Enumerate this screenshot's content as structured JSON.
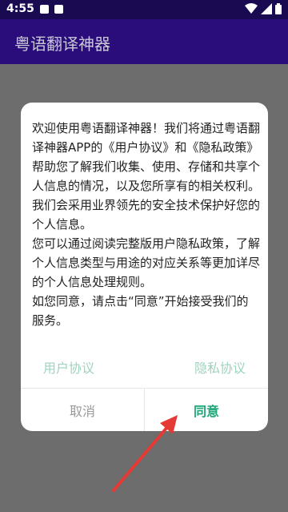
{
  "status_bar": {
    "time": "4:55",
    "icons": [
      "notification-icon",
      "notification-icon",
      "wifi-icon",
      "signal-icon",
      "battery-icon"
    ]
  },
  "app_bar": {
    "title": "粤语翻译神器"
  },
  "dialog": {
    "paragraphs": [
      "欢迎使用粤语翻译神器！我们将通过粤语翻译神器APP的《用户协议》和《隐私政策》帮助您了解我们收集、使用、存储和共享个人信息的情况，以及您所享有的相关权利。",
      "我们会采用业界领先的安全技术保护好您的个人信息。",
      "您可以通过阅读完整版用户隐私政策，了解个人信息类型与用途的对应关系等更加详尽的个人信息处理规则。",
      "如您同意，请点击“同意”开始接受我们的服务。"
    ],
    "link_user_agreement": "用户协议",
    "link_privacy_policy": "隐私协议",
    "cancel": "取消",
    "agree": "同意"
  },
  "colors": {
    "status_bar": "#1a0a52",
    "app_bar": "#2a0c7a",
    "overlay": "#6d6d6d",
    "accent": "#1fa67a",
    "link": "#9fd3bd",
    "arrow": "#e53935"
  }
}
